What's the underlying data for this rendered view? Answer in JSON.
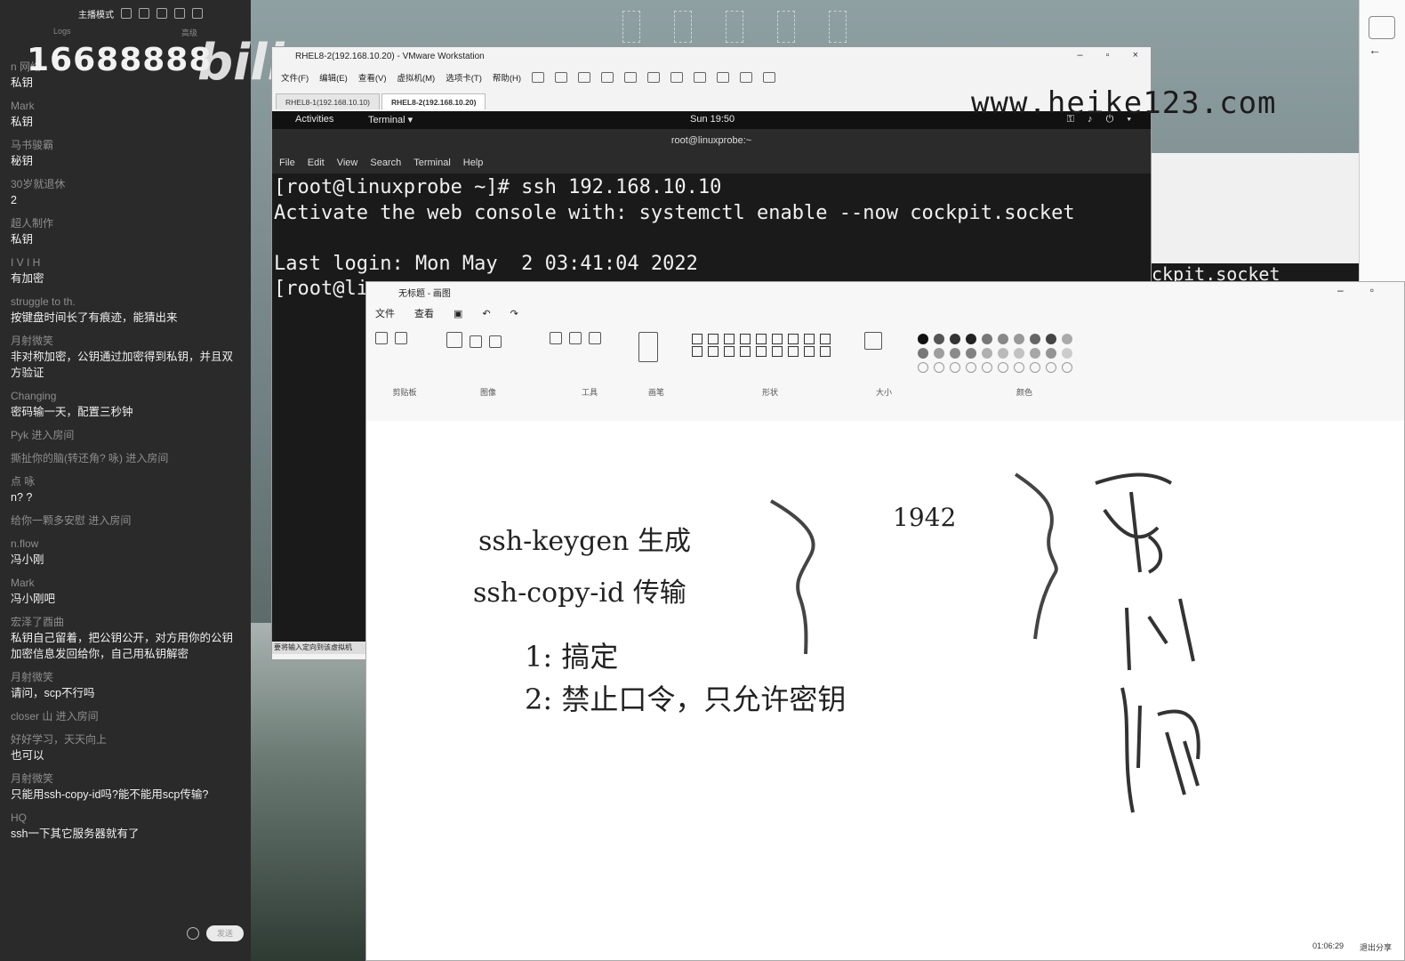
{
  "chat": {
    "mode": "主播模式",
    "tabs": [
      "Logs",
      "高级"
    ],
    "watermark_number": "16688888",
    "watermark_logo": "bilibili",
    "messages": [
      {
        "user": "n 网络",
        "text": "私钥"
      },
      {
        "user": "Mark",
        "text": "私钥"
      },
      {
        "user": "马书骏霸",
        "text": "秘钥"
      },
      {
        "user": "30岁就退休",
        "text": "2"
      },
      {
        "user": "超人制作",
        "text": "私钥"
      },
      {
        "user": "I  V    I    H",
        "text": "有加密"
      },
      {
        "user": "struggle to th.",
        "text": "按键盘时间长了有痕迹，能猜出来"
      },
      {
        "user": "月射微笑",
        "text": "非对称加密，公钥通过加密得到私钥，并且双方验证"
      },
      {
        "user": "Changing",
        "text": "密码输一天，配置三秒钟"
      },
      {
        "user": "Pyk 进入房间",
        "text": ""
      },
      {
        "user": "撕扯你的脑(转还角? 咏) 进入房间",
        "text": ""
      },
      {
        "user": "  点  咏",
        "text": "n? ?"
      },
      {
        "user": "给你一颗多安慰 进入房间",
        "text": ""
      },
      {
        "user": "n.flow",
        "text": "冯小刚"
      },
      {
        "user": "Mark",
        "text": "冯小刚吧"
      },
      {
        "user": "宏泽了酉曲",
        "text": "私钥自己留着，把公钥公开，对方用你的公钥加密信息发回给你，自己用私钥解密"
      },
      {
        "user": "月射微笑",
        "text": "请问，scp不行吗"
      },
      {
        "user": "closer 山   进入房间",
        "text": ""
      },
      {
        "user": "好好学习，天天向上",
        "text": "也可以"
      },
      {
        "user": "月射微笑",
        "text": "只能用ssh-copy-id吗?能不能用scp传输?"
      },
      {
        "user": "HQ",
        "text": "ssh一下其它服务器就有了"
      }
    ],
    "send_label": "发送"
  },
  "vmware": {
    "title": "RHEL8-2(192.168.10.20) - VMware Workstation",
    "menu": [
      "文件(F)",
      "编辑(E)",
      "查看(V)",
      "虚拟机(M)",
      "选项卡(T)",
      "帮助(H)"
    ],
    "tabs": [
      "RHEL8-1(192.168.10.10)",
      "RHEL8-2(192.168.10.20)"
    ],
    "gnome": {
      "activities": "Activities",
      "app": "Terminal ▾",
      "clock": "Sun 19:50",
      "tray": "⚿ ♪ ⏻ ▾"
    },
    "terminal_title": "root@linuxprobe:~",
    "terminal_menu": [
      "File",
      "Edit",
      "View",
      "Search",
      "Terminal",
      "Help"
    ],
    "terminal_lines": [
      "[root@linuxprobe ~]# ssh 192.168.10.10",
      "Activate the web console with: systemctl enable --now cockpit.socket",
      "",
      "Last login: Mon May  2 03:41:04 2022",
      "[root@li"
    ],
    "status_hint": "要将输入定向到该虚拟机"
  },
  "site_watermark": "www.heike123.com",
  "bg_terminal_fragment": "ckpit.socket",
  "paint": {
    "title": "无标题 - 画图",
    "menu": [
      "文件",
      "查看"
    ],
    "groups": [
      "剪贴板",
      "图像",
      "工具",
      "画笔",
      "形状",
      "大小",
      "颜色"
    ],
    "canvas_text": {
      "line1": "ssh-keygen 生成",
      "line2": "ssh-copy-id 传输",
      "num": "1942",
      "item1": "1: 搞定",
      "item2": "2: 禁止口令，只允许密钥",
      "hand": "密 山 帐"
    },
    "colors": [
      "#111111",
      "#555555",
      "#333333",
      "#222222",
      "#777777",
      "#888888",
      "#999999",
      "#666666",
      "#444444",
      "#aaaaaa"
    ],
    "status": {
      "time": "01:06:29",
      "share": "退出分享"
    }
  }
}
